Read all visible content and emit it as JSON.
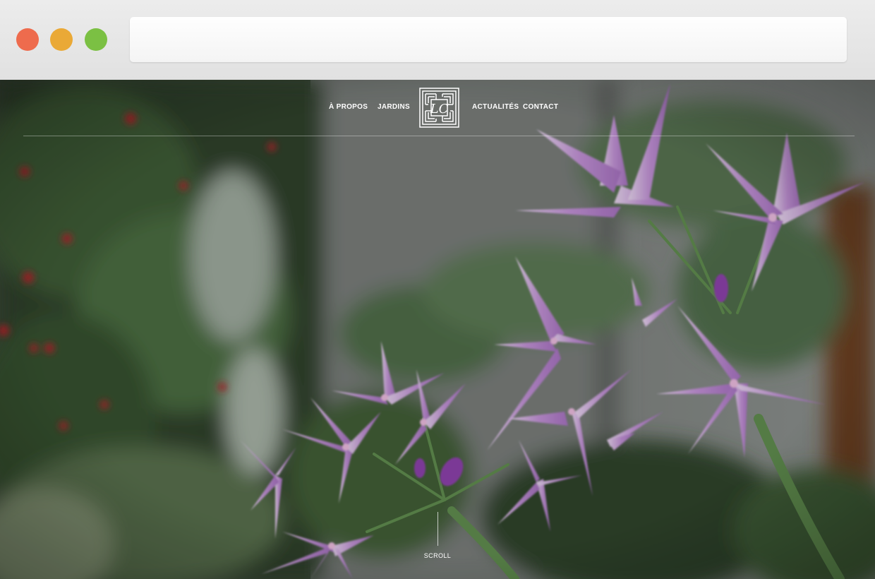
{
  "browser": {
    "address_value": "",
    "address_placeholder": ""
  },
  "nav": {
    "links": [
      "À PROPOS",
      "JARDINS",
      "ACTUALITÉS",
      "CONTACT"
    ],
    "logo_monogram": "LC"
  },
  "hero": {
    "scroll_label": "SCROLL"
  },
  "colors": {
    "traffic_red": "#ee6b4d",
    "traffic_yellow": "#eaa936",
    "traffic_green": "#7bc043",
    "flower_purple": "#c89ad8",
    "foliage_green": "#4d6b4a"
  }
}
